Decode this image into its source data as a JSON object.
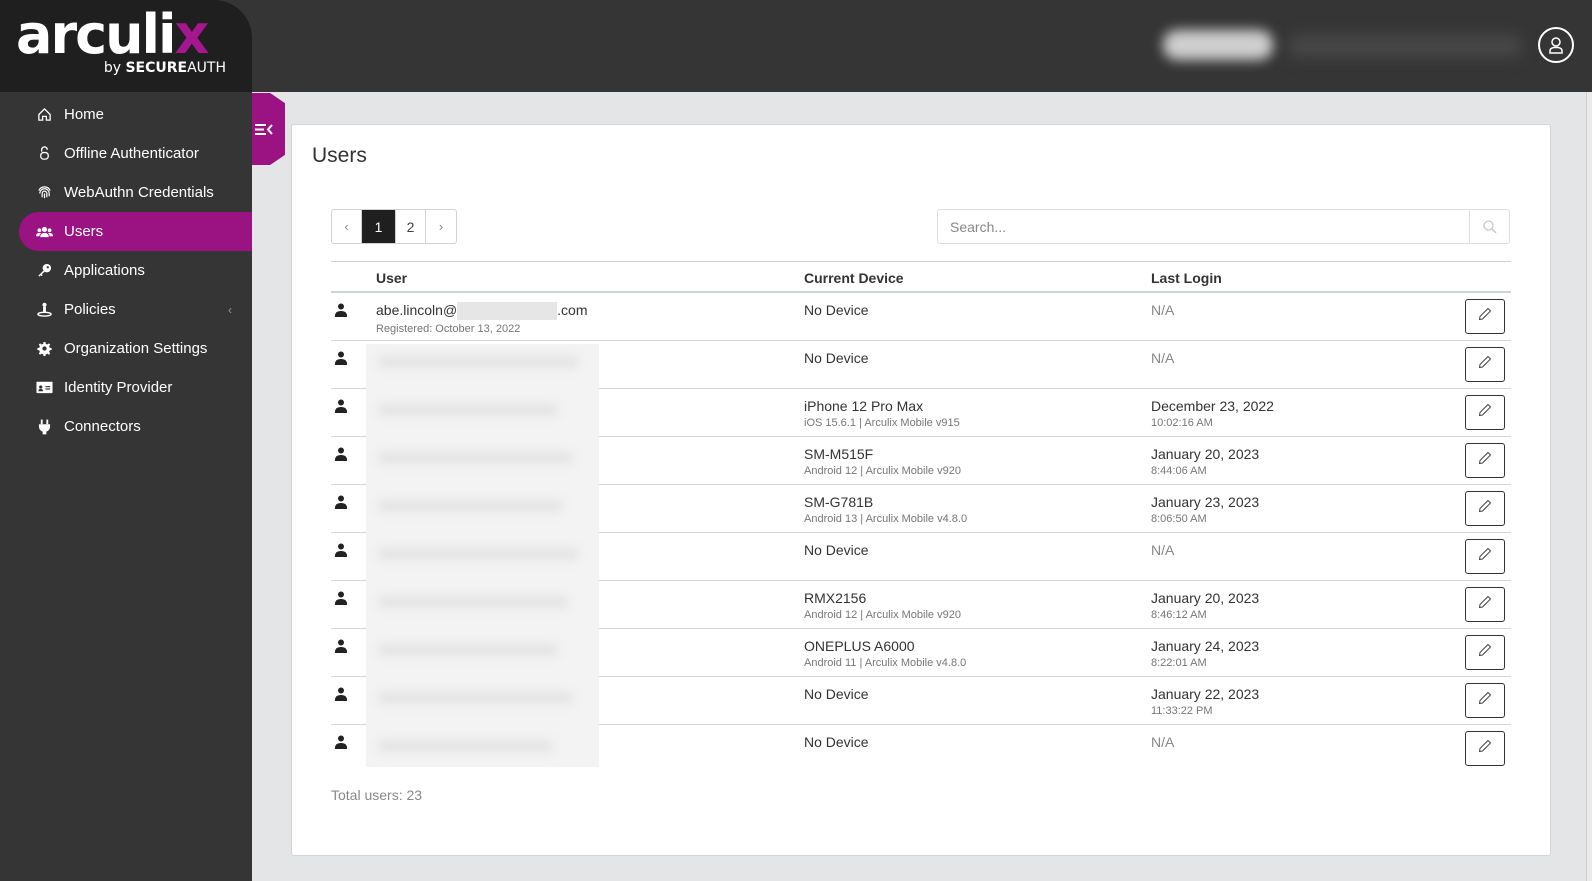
{
  "brand": {
    "logo_main": "arculi",
    "logo_accent": "x",
    "logo_by": "by",
    "logo_secure": "SECURE",
    "logo_auth": "AUTH",
    "accent_color": "#9b1283"
  },
  "header": {
    "user_menu_icon": "user-circle-icon"
  },
  "sidebar": {
    "items": [
      {
        "label": "Home",
        "icon": "home-icon"
      },
      {
        "label": "Offline Authenticator",
        "icon": "lock-icon"
      },
      {
        "label": "WebAuthn Credentials",
        "icon": "fingerprint-icon"
      },
      {
        "label": "Users",
        "icon": "users-icon",
        "active": true
      },
      {
        "label": "Applications",
        "icon": "key-icon"
      },
      {
        "label": "Policies",
        "icon": "policy-icon",
        "has_submenu": true
      },
      {
        "label": "Organization Settings",
        "icon": "gear-icon"
      },
      {
        "label": "Identity Provider",
        "icon": "id-card-icon"
      },
      {
        "label": "Connectors",
        "icon": "plug-icon"
      }
    ],
    "submenu_chevron": "‹"
  },
  "main": {
    "title": "Users",
    "pagination": {
      "prev": "‹",
      "pages": [
        "1",
        "2"
      ],
      "current": "1",
      "next": "›"
    },
    "search": {
      "placeholder": "Search...",
      "value": ""
    },
    "table": {
      "columns": [
        "User",
        "Current Device",
        "Last Login"
      ],
      "rows": [
        {
          "user": "abe.lincoln@",
          "user_suffix": ".com",
          "registered": "Registered: October 13, 2022",
          "device": "No Device",
          "device_detail": "",
          "login_date": "N/A",
          "login_time": ""
        },
        {
          "user": "",
          "registered": "",
          "device": "No Device",
          "device_detail": "",
          "login_date": "N/A",
          "login_time": ""
        },
        {
          "user": "",
          "registered": "",
          "device": "iPhone 12 Pro Max",
          "device_detail": "iOS 15.6.1 | Arculix Mobile v915",
          "login_date": "December 23, 2022",
          "login_time": "10:02:16 AM"
        },
        {
          "user": "",
          "registered": "",
          "device": "SM-M515F",
          "device_detail": "Android 12 | Arculix Mobile v920",
          "login_date": "January 20, 2023",
          "login_time": "8:44:06 AM"
        },
        {
          "user": "",
          "registered": "",
          "device": "SM-G781B",
          "device_detail": "Android 13 | Arculix Mobile v4.8.0",
          "login_date": "January 23, 2023",
          "login_time": "8:06:50 AM"
        },
        {
          "user": "",
          "registered": "",
          "device": "No Device",
          "device_detail": "",
          "login_date": "N/A",
          "login_time": ""
        },
        {
          "user": "",
          "registered": "",
          "device": "RMX2156",
          "device_detail": "Android 12 | Arculix Mobile v920",
          "login_date": "January 20, 2023",
          "login_time": "8:46:12 AM"
        },
        {
          "user": "",
          "registered": "",
          "device": "ONEPLUS A6000",
          "device_detail": "Android 11 | Arculix Mobile v4.8.0",
          "login_date": "January 24, 2023",
          "login_time": "8:22:01 AM"
        },
        {
          "user": "",
          "registered": "",
          "device": "No Device",
          "device_detail": "",
          "login_date": "January 22, 2023",
          "login_time": "11:33:22 PM"
        },
        {
          "user": "",
          "registered": "",
          "device": "No Device",
          "device_detail": "",
          "login_date": "N/A",
          "login_time": ""
        }
      ]
    },
    "total": "Total users: 23"
  }
}
